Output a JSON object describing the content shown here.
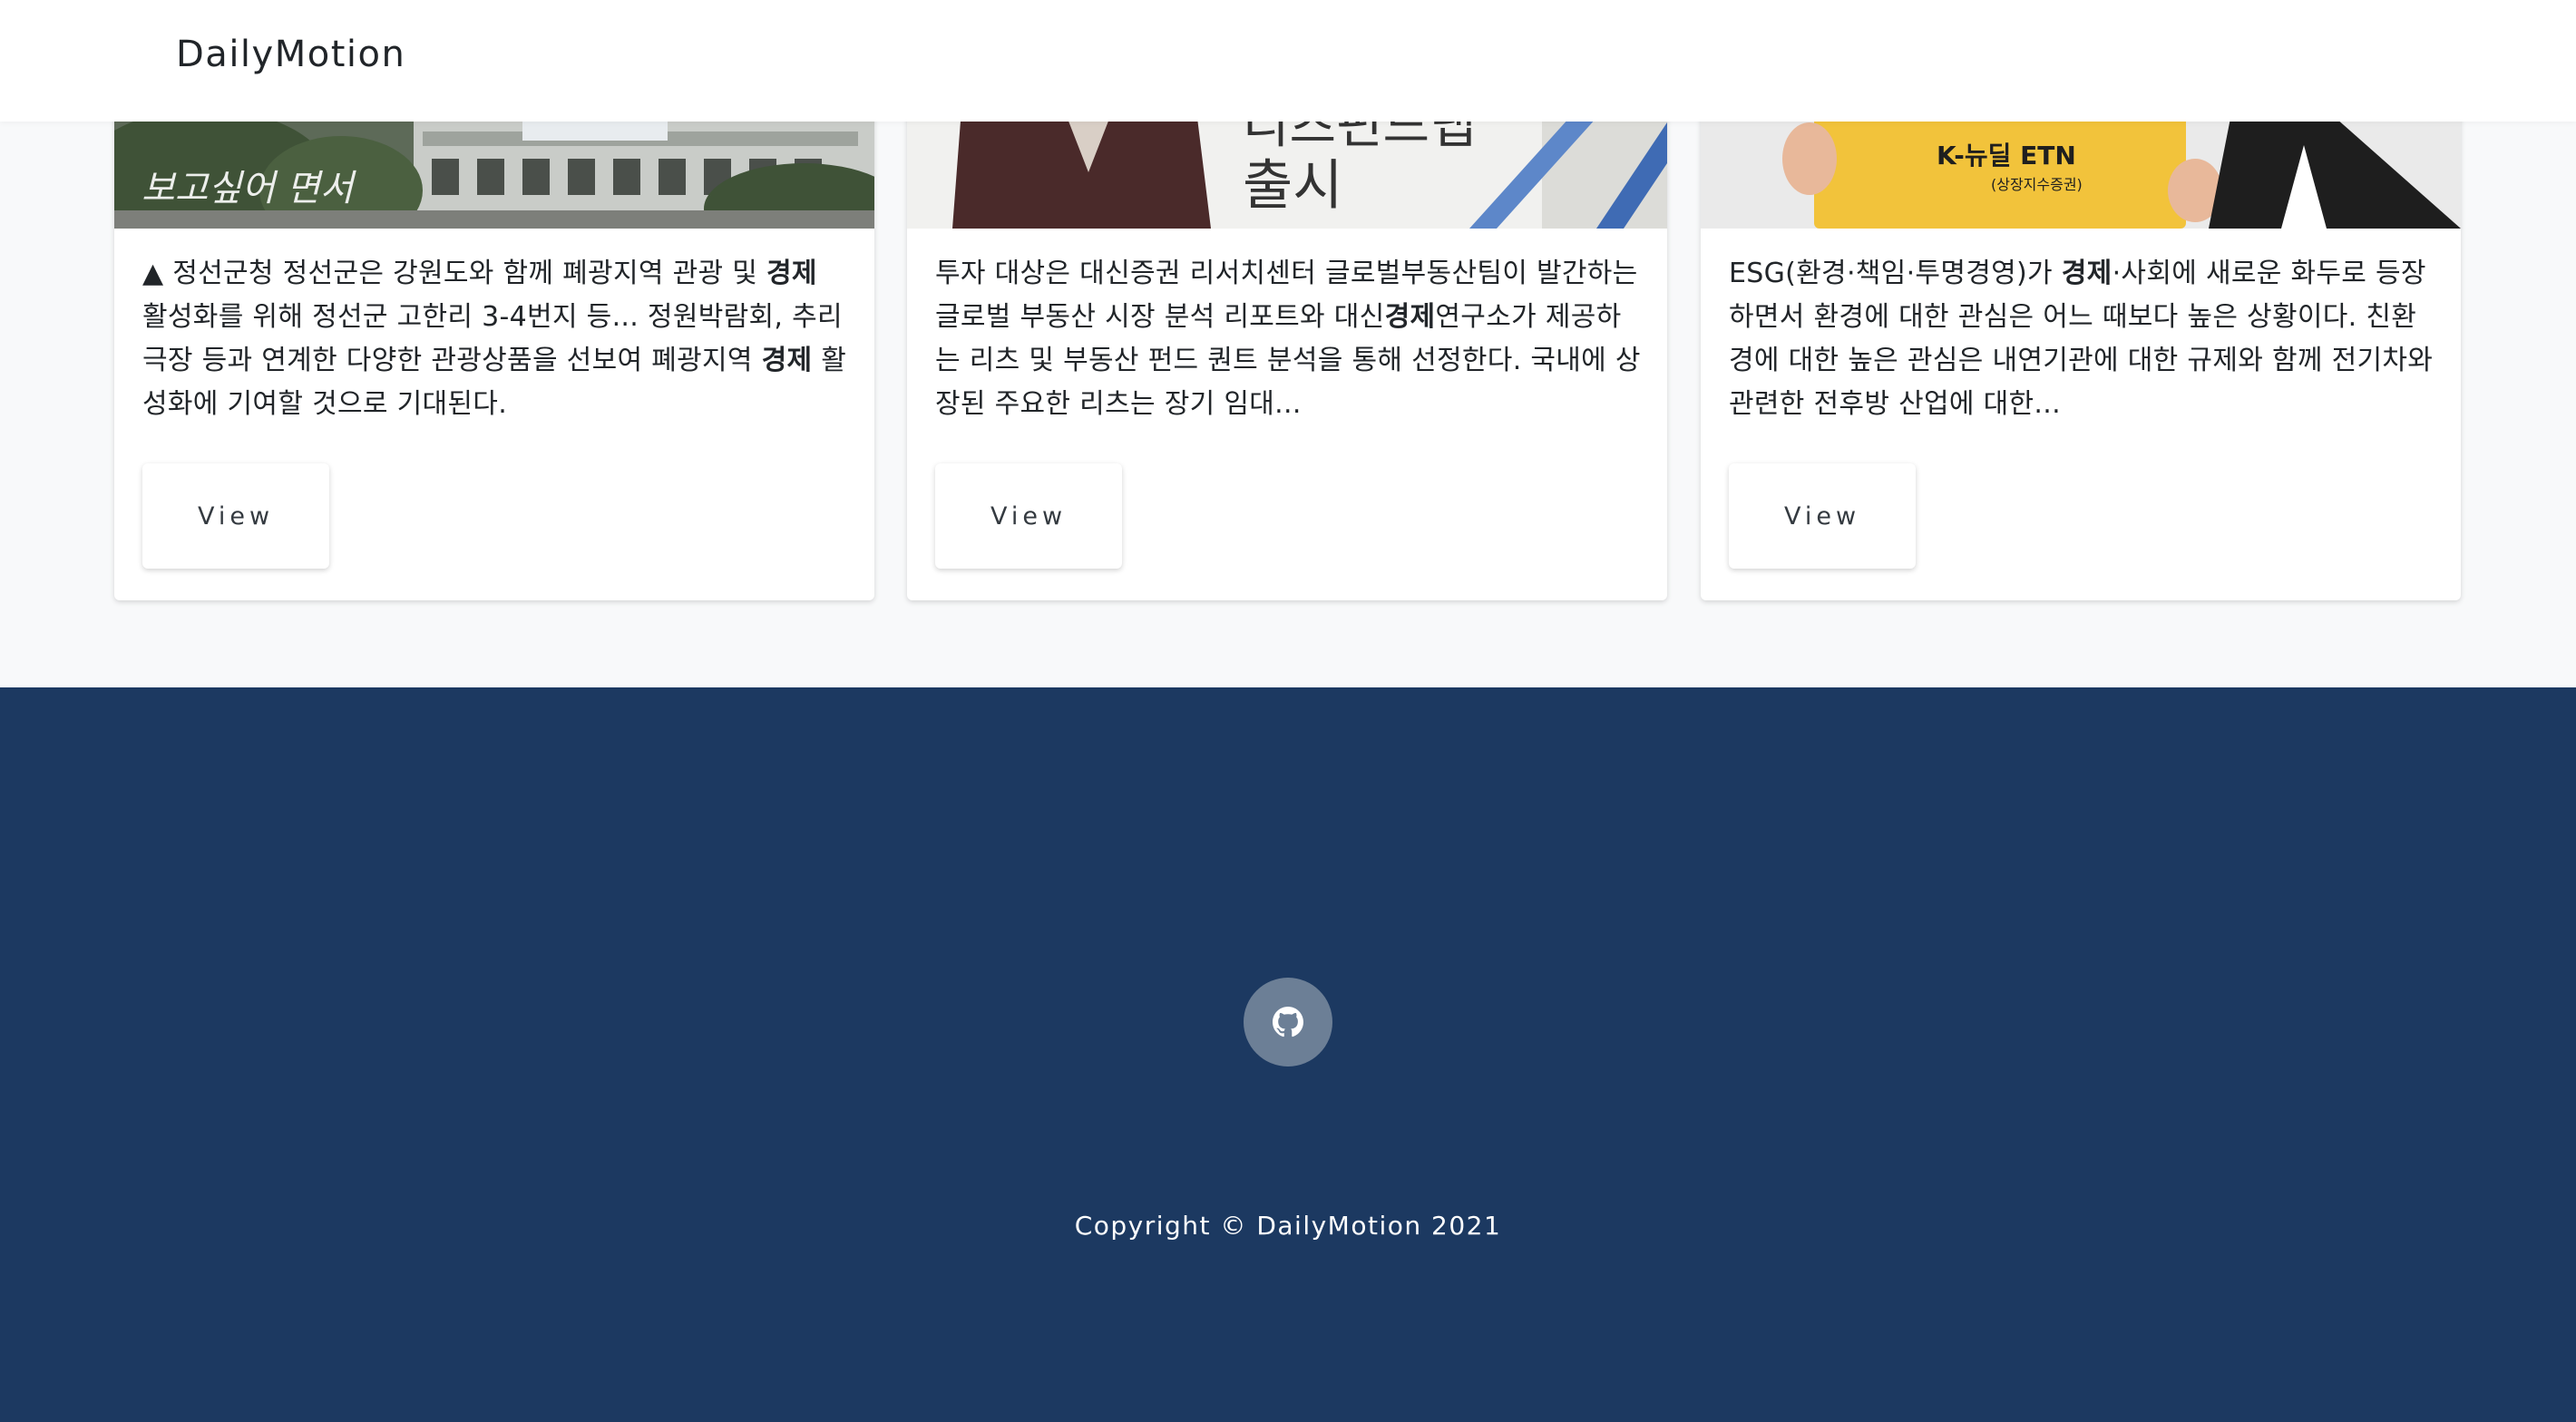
{
  "nav": {
    "brand": "DailyMotion"
  },
  "cards": [
    {
      "image_text": "보고싶어 면서",
      "text_parts": [
        "▲ 정선군청  정선군은 강원도와 함께 폐광지역 관광 및 ",
        "경제",
        " 활성화를 위해 정선군 고한리 3-4번지 등... 정원박람회, 추리극장 등과 연계한 다양한 관광상품을 선보여 폐광지역 ",
        "경제",
        " 활성화에 기여할 것으로 기대된다."
      ],
      "button": "View"
    },
    {
      "image_text_1": "리츠펀드랩",
      "image_text_2": "출시",
      "text_parts": [
        "투자 대상은 대신증권 리서치센터 글로벌부동산팀이 발간하는 글로벌 부동산 시장 분석 리포트와 대신",
        "경제",
        "연구소가 제공하는 리츠 및 부동산 펀드 퀀트 분석을 통해 선정한다. 국내에 상장된 주요한 리츠는 장기 임대..."
      ],
      "button": "View"
    },
    {
      "image_text_1": "K-뉴딜 ETN",
      "image_text_2": "(상장지수증권)",
      "text_parts": [
        "ESG(환경·책임·투명경영)가 ",
        "경제",
        "·사회에 새로운 화두로 등장하면서 환경에 대한 관심은 어느 때보다 높은 상황이다. 친환경에 대한 높은 관심은 내연기관에 대한 규제와 함께 전기차와 관련한 전후방 산업에 대한..."
      ],
      "button": "View"
    }
  ],
  "footer": {
    "copyright": "Copyright © DailyMotion 2021",
    "social_icon": "github-icon"
  },
  "colors": {
    "footer_bg": "#1c3961",
    "page_bg": "#f8f9fa",
    "social_circle": "#6c7f96"
  }
}
